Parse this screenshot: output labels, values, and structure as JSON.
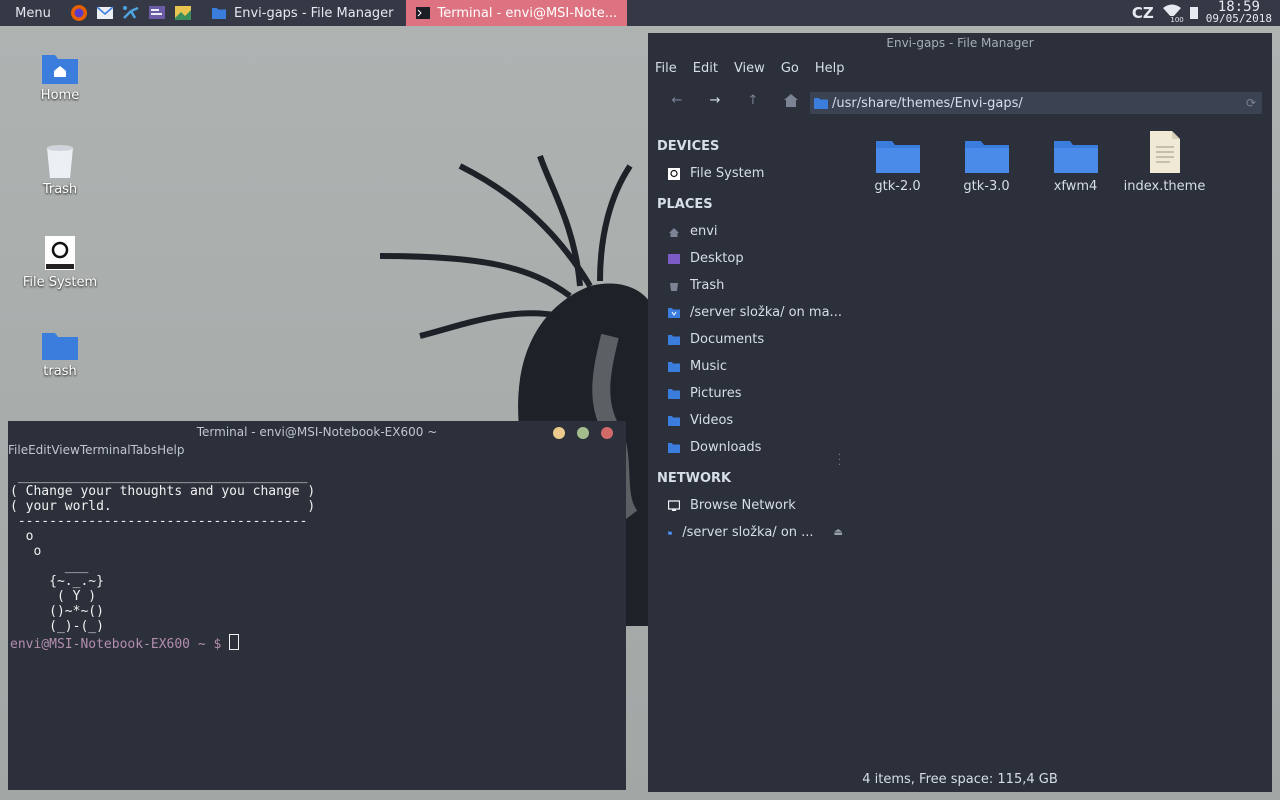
{
  "panel": {
    "menu_label": "Menu",
    "launchers": [
      "firefox-icon",
      "mail-icon",
      "tools-icon",
      "settings-icon",
      "image-viewer-icon"
    ],
    "tasks": [
      {
        "label": "Envi-gaps - File Manager",
        "active": false
      },
      {
        "label": "Terminal - envi@MSI-Note...",
        "active": true
      }
    ],
    "keyboard_layout": "CZ",
    "wifi_level": "100",
    "time": "18:59",
    "date": "09/05/2018"
  },
  "desktop": {
    "icons": [
      {
        "label": "Home"
      },
      {
        "label": "Trash"
      },
      {
        "label": "File System"
      },
      {
        "label": "trash"
      }
    ]
  },
  "terminal": {
    "title": "Terminal - envi@MSI-Notebook-EX600 ~",
    "menu": [
      "File",
      "Edit",
      "View",
      "Terminal",
      "Tabs",
      "Help"
    ],
    "output": " _____________________________________\n( Change your thoughts and you change )\n( your world.                         )\n -------------------------------------\n  o\n   o\n       ___\n     {~._.~}\n      ( Y )\n     ()~*~()\n     (_)-(_)",
    "prompt": "envi@MSI-Notebook-EX600 ~ $ "
  },
  "file_manager": {
    "title": "Envi-gaps - File Manager",
    "menu": [
      "File",
      "Edit",
      "View",
      "Go",
      "Help"
    ],
    "location": "/usr/share/themes/Envi-gaps/",
    "sections": [
      {
        "title": "DEVICES",
        "items": [
          {
            "label": "File System",
            "icon": "drive-icon"
          }
        ]
      },
      {
        "title": "PLACES",
        "items": [
          {
            "label": "envi",
            "icon": "home-icon"
          },
          {
            "label": "Desktop",
            "icon": "desktop-icon"
          },
          {
            "label": "Trash",
            "icon": "trash-icon"
          },
          {
            "label": "/server složka/ on ma...",
            "icon": "network-folder-icon"
          },
          {
            "label": "Documents",
            "icon": "documents-folder-icon"
          },
          {
            "label": "Music",
            "icon": "music-folder-icon"
          },
          {
            "label": "Pictures",
            "icon": "pictures-folder-icon"
          },
          {
            "label": "Videos",
            "icon": "videos-folder-icon"
          },
          {
            "label": "Downloads",
            "icon": "downloads-folder-icon"
          }
        ]
      },
      {
        "title": "NETWORK",
        "items": [
          {
            "label": "Browse Network",
            "icon": "network-icon"
          },
          {
            "label": "/server složka/ on ...",
            "icon": "network-folder-icon"
          }
        ]
      }
    ],
    "files": [
      {
        "name": "gtk-2.0",
        "type": "folder"
      },
      {
        "name": "gtk-3.0",
        "type": "folder"
      },
      {
        "name": "xfwm4",
        "type": "folder"
      },
      {
        "name": "index.theme",
        "type": "file"
      }
    ],
    "status": "4 items, Free space: 115,4 GB"
  },
  "colors": {
    "panel_bg": "#343945",
    "window_bg": "#2b303b",
    "accent_folder": "#3b7ddd",
    "active_task": "#dd7380",
    "prompt": "#b48ead"
  }
}
